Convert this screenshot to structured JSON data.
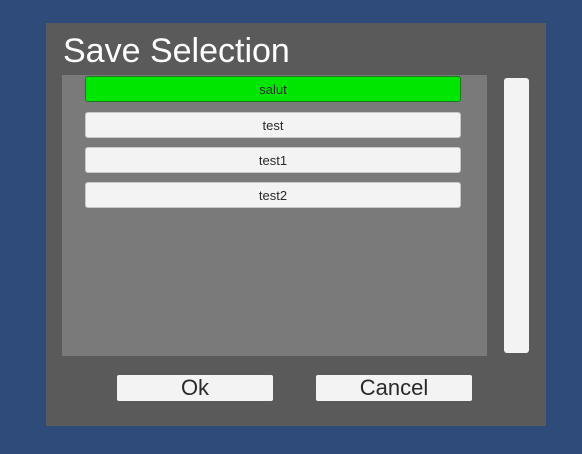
{
  "dialog": {
    "title": "Save Selection",
    "items": [
      {
        "label": "salut",
        "selected": true
      },
      {
        "label": "test",
        "selected": false
      },
      {
        "label": "test1",
        "selected": false
      },
      {
        "label": "test2",
        "selected": false
      }
    ],
    "ok_label": "Ok",
    "cancel_label": "Cancel"
  },
  "colors": {
    "background": "#2f4b79",
    "dialog": "#5a5a5a",
    "list_panel": "#7a7a7a",
    "selected_item": "#00e600",
    "item": "#f3f3f3"
  }
}
